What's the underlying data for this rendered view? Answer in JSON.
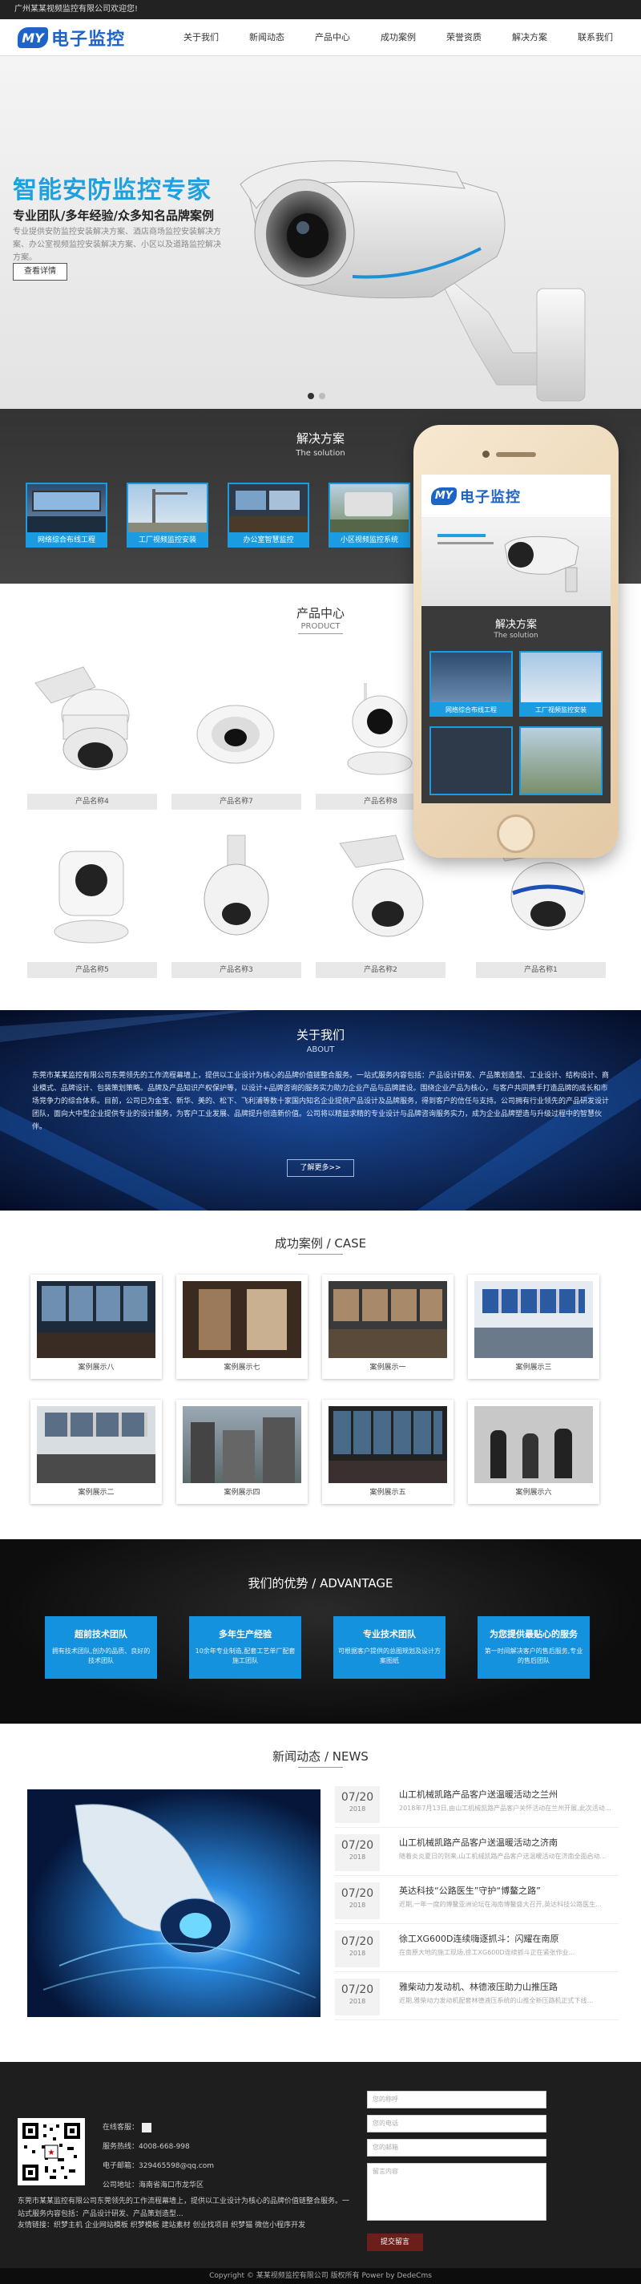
{
  "topbar": {
    "text": "广州某某视频监控有限公司欢迎您!"
  },
  "header": {
    "logo_mark": "MY",
    "logo_text": "电子监控",
    "nav": [
      "关于我们",
      "新闻动态",
      "产品中心",
      "成功案例",
      "荣誉资质",
      "解决方案",
      "联系我们"
    ]
  },
  "banner": {
    "title": "智能安防监控专家",
    "subtitle": "专业团队/多年经验/众多知名品牌案例",
    "desc": "专业提供安防监控安装解决方案、酒店商场监控安装解决方案、办公室视频监控安装解决方案、小区以及道路监控解决方案。",
    "button": "查看详情"
  },
  "solution": {
    "title": "解决方案",
    "subtitle": "The solution",
    "items": [
      "网络综合布线工程",
      "工厂视频监控安装",
      "办公室智慧监控",
      "小区视频监控系统"
    ]
  },
  "products": {
    "title": "产品中心",
    "subtitle": "PRODUCT",
    "items": [
      "产品名称4",
      "产品名称7",
      "产品名称8",
      "产品名称5",
      "产品名称3",
      "产品名称2",
      "产品名称1"
    ]
  },
  "phone": {
    "logo_mark": "MY",
    "logo_text": "电子监控",
    "sol_title": "解决方案",
    "sol_sub": "The solution",
    "items": [
      "网络综合布线工程",
      "工厂视频监控安装"
    ]
  },
  "about": {
    "title": "关于我们",
    "subtitle": "ABOUT",
    "text": "东莞市某某监控有限公司东莞领先的工作流程幕墙上，提供以工业设计为核心的品牌价值链整合服务。一站式服务内容包括：产品设计研发、产品策划造型、工业设计、结构设计、商业模式、品牌设计、包装策划策略。品牌及产品知识产权保护等，以设计+品牌咨询的服务实力助力企业产品与品牌建设。围绕企业产品为核心，与客户共同携手打造品牌的成长和市场竞争力的综合体系。目前，公司已为金宝、新华、美的、松下、飞利浦等数十家国内知名企业提供产品设计及品牌服务，得到客户的信任与支持。公司拥有行业领先的产品研发设计团队，面向大中型企业提供专业的设计服务，为客户工业发展、品牌提升创造新价值。公司将以精益求精的专业设计与品牌咨询服务实力，成为企业品牌塑造与升级过程中的智慧伙伴。",
    "button": "了解更多>>"
  },
  "cases": {
    "title": "成功案例 / CASE",
    "items": [
      "案例展示八",
      "案例展示七",
      "案例展示一",
      "案例展示三",
      "案例展示二",
      "案例展示四",
      "案例展示五",
      "案例展示六"
    ]
  },
  "advantage": {
    "title": "我们的优势 / ADVANTAGE",
    "items": [
      {
        "title": "超前技术团队",
        "desc": "拥有技术团队,创办的品质、良好的技术团队"
      },
      {
        "title": "多年生产经验",
        "desc": "10余年专业制造,配套工艺单厂配套施工团队"
      },
      {
        "title": "专业技术团队",
        "desc": "可根据客户提供的总图规划及设计方案图纸"
      },
      {
        "title": "为您提供最贴心的服务",
        "desc": "第一时间解决客户的售后服务,专业的售后团队"
      }
    ]
  },
  "news": {
    "title": "新闻动态 / NEWS",
    "items": [
      {
        "day": "07/20",
        "year": "2018",
        "title": "山工机械凯路产品客户送温暖活动之兰州",
        "desc": "2018年7月13日,由山工机械凯路产品客户关怀活动在兰州开展,此次活动由..."
      },
      {
        "day": "07/20",
        "year": "2018",
        "title": "山工机械凯路产品客户送温暖活动之济南",
        "desc": "随着炎炎夏日的到来,山工机械凯路产品客户送温暖活动在济南全面启动..."
      },
      {
        "day": "07/20",
        "year": "2018",
        "title": "英达科技“公路医生”守护“博鳌之路”",
        "desc": "近期,一年一度的博鳌亚洲论坛在海南博鳌盛大召开,英达科技公路医生..."
      },
      {
        "day": "07/20",
        "year": "2018",
        "title": "徐工XG600D连续嗨逐抓斗：闪耀在南原",
        "desc": "在南原大地的施工现场,徐工XG600D连续抓斗正在紧张作业..."
      },
      {
        "day": "07/20",
        "year": "2018",
        "title": "雅柴动力发动机、林德液压助力山推压路",
        "desc": "近期,雅柴动力发动机配套林德液压系统的山推全新压路机正式下线..."
      }
    ]
  },
  "footer": {
    "online_label": "在线客服：",
    "phone": "服务热线：4008-668-998",
    "email": "电子邮箱：329465598@qq.com",
    "address": "公司地址：海南省海口市龙华区",
    "desc": "东莞市某某监控有限公司东莞领先的工作流程幕墙上，提供以工业设计为核心的品牌价值链整合服务。一站式服务内容包括：产品设计研发、产品策划造型...",
    "links": "友情链接：织梦主机  企业网站模板  织梦模板  建站素材  创业找项目  织梦猫  微信小程序开发",
    "form_placeholders": [
      "您的称呼",
      "您的电话",
      "您的邮箱",
      "留言内容"
    ],
    "submit": "提交留言",
    "copyright": "Copyright © 某某视频监控有限公司 版权所有  Power by DedeCms"
  }
}
